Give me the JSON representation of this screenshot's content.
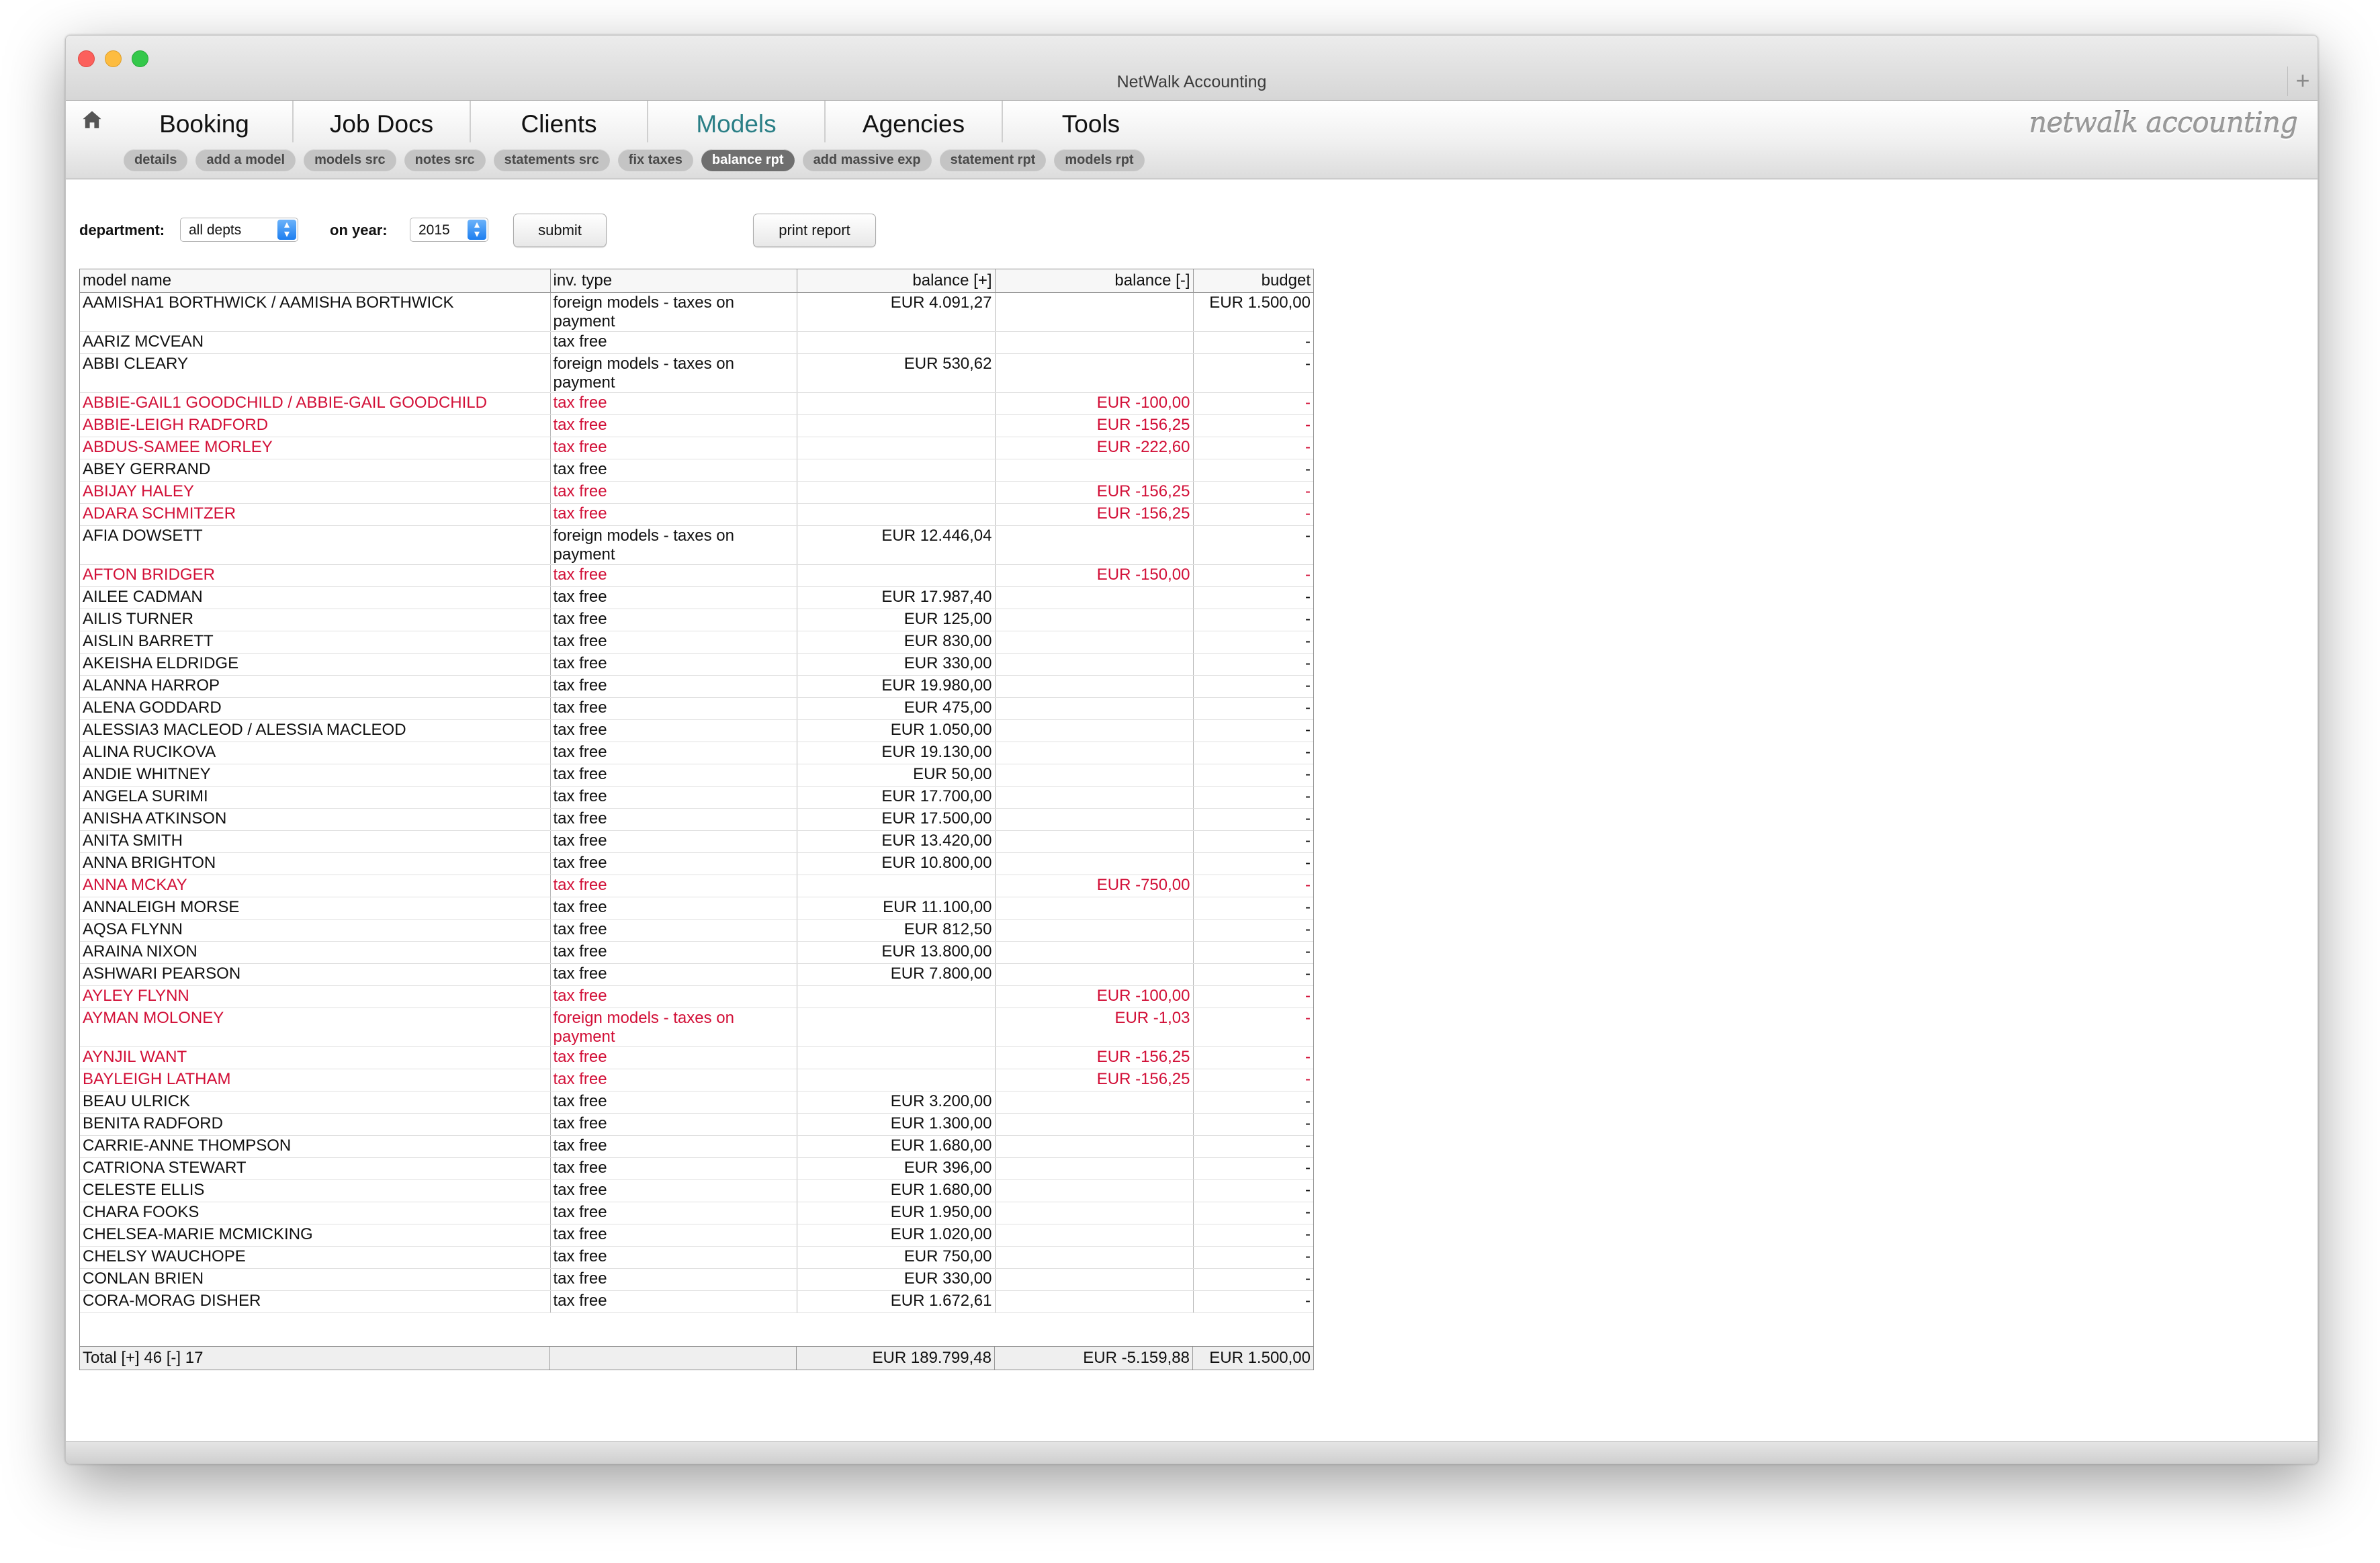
{
  "window": {
    "title": "NetWalk Accounting",
    "add_symbol": "+"
  },
  "nav": {
    "home_icon": "home-icon",
    "tabs": [
      "Booking",
      "Job Docs",
      "Clients",
      "Models",
      "Agencies",
      "Tools"
    ],
    "active_tab": "Models",
    "brand": "netwalk accounting"
  },
  "subtabs": {
    "items": [
      "details",
      "add a model",
      "models src",
      "notes src",
      "statements src",
      "fix taxes",
      "balance rpt",
      "add massive exp",
      "statement rpt",
      "models rpt"
    ],
    "active": "balance rpt"
  },
  "filters": {
    "department_label": "department:",
    "department_value": "all depts",
    "year_label": "on year:",
    "year_value": "2015",
    "submit_label": "submit",
    "print_label": "print report"
  },
  "table": {
    "headers": [
      "model name",
      "inv. type",
      "balance [+]",
      "balance [-]",
      "budget"
    ],
    "rows": [
      [
        "AAMISHA1 BORTHWICK / AAMISHA BORTHWICK",
        "foreign models - taxes on payment",
        "EUR 4.091,27",
        "",
        "EUR 1.500,00"
      ],
      [
        "AARIZ MCVEAN",
        "tax free",
        "",
        "",
        "-"
      ],
      [
        "ABBI CLEARY",
        "foreign models - taxes on payment",
        "EUR 530,62",
        "",
        "-"
      ],
      [
        "ABBIE-GAIL1 GOODCHILD / ABBIE-GAIL GOODCHILD",
        "tax free",
        "",
        "EUR -100,00",
        "-"
      ],
      [
        "ABBIE-LEIGH RADFORD",
        "tax free",
        "",
        "EUR -156,25",
        "-"
      ],
      [
        "ABDUS-SAMEE MORLEY",
        "tax free",
        "",
        "EUR -222,60",
        "-"
      ],
      [
        "ABEY GERRAND",
        "tax free",
        "",
        "",
        "-"
      ],
      [
        "ABIJAY HALEY",
        "tax free",
        "",
        "EUR -156,25",
        "-"
      ],
      [
        "ADARA SCHMITZER",
        "tax free",
        "",
        "EUR -156,25",
        "-"
      ],
      [
        "AFIA DOWSETT",
        "foreign models - taxes on payment",
        "EUR 12.446,04",
        "",
        "-"
      ],
      [
        "AFTON BRIDGER",
        "tax free",
        "",
        "EUR -150,00",
        "-"
      ],
      [
        "AILEE CADMAN",
        "tax free",
        "EUR 17.987,40",
        "",
        "-"
      ],
      [
        "AILIS TURNER",
        "tax free",
        "EUR 125,00",
        "",
        "-"
      ],
      [
        "AISLIN BARRETT",
        "tax free",
        "EUR 830,00",
        "",
        "-"
      ],
      [
        "AKEISHA ELDRIDGE",
        "tax free",
        "EUR 330,00",
        "",
        "-"
      ],
      [
        "ALANNA HARROP",
        "tax free",
        "EUR 19.980,00",
        "",
        "-"
      ],
      [
        "ALENA GODDARD",
        "tax free",
        "EUR 475,00",
        "",
        "-"
      ],
      [
        "ALESSIA3 MACLEOD / ALESSIA MACLEOD",
        "tax free",
        "EUR 1.050,00",
        "",
        "-"
      ],
      [
        "ALINA RUCIKOVA",
        "tax free",
        "EUR 19.130,00",
        "",
        "-"
      ],
      [
        "ANDIE WHITNEY",
        "tax free",
        "EUR 50,00",
        "",
        "-"
      ],
      [
        "ANGELA SURIMI",
        "tax free",
        "EUR 17.700,00",
        "",
        "-"
      ],
      [
        "ANISHA ATKINSON",
        "tax free",
        "EUR 17.500,00",
        "",
        "-"
      ],
      [
        "ANITA SMITH",
        "tax free",
        "EUR 13.420,00",
        "",
        "-"
      ],
      [
        "ANNA BRIGHTON",
        "tax free",
        "EUR 10.800,00",
        "",
        "-"
      ],
      [
        "ANNA MCKAY",
        "tax free",
        "",
        "EUR -750,00",
        "-"
      ],
      [
        "ANNALEIGH MORSE",
        "tax free",
        "EUR 11.100,00",
        "",
        "-"
      ],
      [
        "AQSA FLYNN",
        "tax free",
        "EUR 812,50",
        "",
        "-"
      ],
      [
        "ARAINA NIXON",
        "tax free",
        "EUR 13.800,00",
        "",
        "-"
      ],
      [
        "ASHWARI PEARSON",
        "tax free",
        "EUR 7.800,00",
        "",
        "-"
      ],
      [
        "AYLEY FLYNN",
        "tax free",
        "",
        "EUR -100,00",
        "-"
      ],
      [
        "AYMAN MOLONEY",
        "foreign models - taxes on payment",
        "",
        "EUR -1,03",
        "-"
      ],
      [
        "AYNJIL WANT",
        "tax free",
        "",
        "EUR -156,25",
        "-"
      ],
      [
        "BAYLEIGH LATHAM",
        "tax free",
        "",
        "EUR -156,25",
        "-"
      ],
      [
        "BEAU ULRICK",
        "tax free",
        "EUR 3.200,00",
        "",
        "-"
      ],
      [
        "BENITA RADFORD",
        "tax free",
        "EUR 1.300,00",
        "",
        "-"
      ],
      [
        "CARRIE-ANNE THOMPSON",
        "tax free",
        "EUR 1.680,00",
        "",
        "-"
      ],
      [
        "CATRIONA STEWART",
        "tax free",
        "EUR 396,00",
        "",
        "-"
      ],
      [
        "CELESTE ELLIS",
        "tax free",
        "EUR 1.680,00",
        "",
        "-"
      ],
      [
        "CHARA FOOKS",
        "tax free",
        "EUR 1.950,00",
        "",
        "-"
      ],
      [
        "CHELSEA-MARIE MCMICKING",
        "tax free",
        "EUR 1.020,00",
        "",
        "-"
      ],
      [
        "CHELSY WAUCHOPE",
        "tax free",
        "EUR 750,00",
        "",
        "-"
      ],
      [
        "CONLAN BRIEN",
        "tax free",
        "EUR 330,00",
        "",
        "-"
      ],
      [
        "CORA-MORAG DISHER",
        "tax free",
        "EUR 1.672,61",
        "",
        "-"
      ]
    ],
    "negative_color": "#d20f37",
    "total": {
      "label": "Total   [+] 46   [-] 17",
      "inv_type": "",
      "balance_pos": "EUR 189.799,48",
      "balance_neg": "EUR -5.159,88",
      "budget": "EUR 1.500,00"
    }
  }
}
